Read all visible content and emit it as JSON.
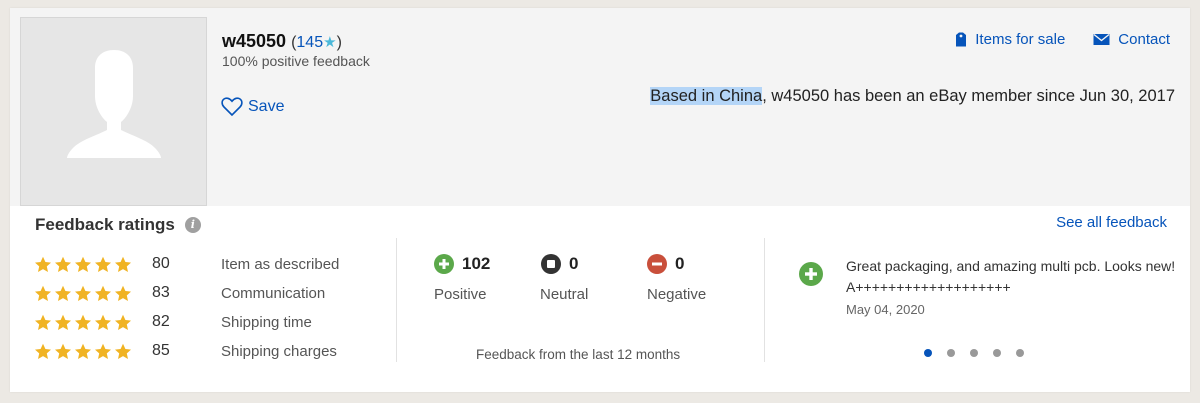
{
  "seller": {
    "username": "w45050",
    "score_open": "(",
    "score": "145",
    "score_close": ")",
    "positive_feedback": "100% positive feedback",
    "save_label": "Save",
    "based_highlight": "Based in China",
    "based_rest": ", w45050 has been an eBay member since Jun 30, 2017"
  },
  "links": {
    "items_for_sale": "Items for sale",
    "contact": "Contact"
  },
  "feedback": {
    "title": "Feedback ratings",
    "see_all": "See all feedback",
    "ratings": [
      {
        "score": "80",
        "label": "Item as described",
        "stars": 5
      },
      {
        "score": "83",
        "label": "Communication",
        "stars": 5
      },
      {
        "score": "82",
        "label": "Shipping time",
        "stars": 5
      },
      {
        "score": "85",
        "label": "Shipping charges",
        "stars": 5
      }
    ],
    "positive": {
      "count": "102",
      "label": "Positive"
    },
    "neutral": {
      "count": "0",
      "label": "Neutral"
    },
    "negative": {
      "count": "0",
      "label": "Negative"
    },
    "period": "Feedback from the last 12 months",
    "comment": {
      "text": "Great packaging, and amazing multi pcb. Looks new! A+++++++++++++++++++",
      "date": "May 04, 2020"
    },
    "carousel_active": 1
  },
  "colors": {
    "link": "#0654ba",
    "star": "#f0b323",
    "positive": "#5ba84a",
    "neutral": "#333333",
    "negative": "#c94f3b",
    "highlight": "#b4d5f7"
  },
  "icons": {
    "avatar": "avatar-placeholder-icon",
    "score_star": "star-icon",
    "save": "heart-outline-icon",
    "items_for_sale": "tag-icon",
    "contact": "envelope-icon",
    "info": "info-icon",
    "rating_star": "star-icon",
    "positive": "plus-circle-icon",
    "neutral": "stop-circle-icon",
    "negative": "minus-circle-icon",
    "carousel_dot": "dot-icon"
  }
}
